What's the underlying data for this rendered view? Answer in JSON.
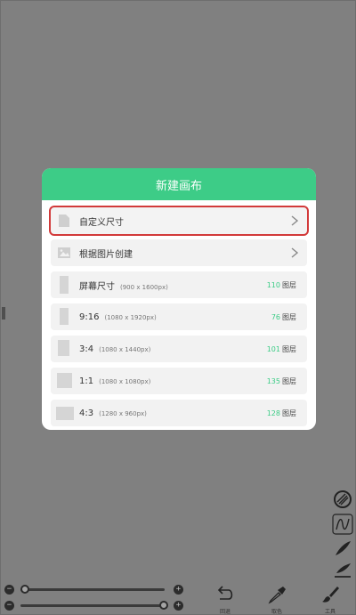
{
  "dialog": {
    "title": "新建画布",
    "options": [
      {
        "label": "自定义尺寸",
        "dims": "",
        "count": "",
        "layer": "",
        "icon": "document-icon",
        "chevron": true
      },
      {
        "label": "根据图片创建",
        "dims": "",
        "count": "",
        "layer": "",
        "icon": "image-icon",
        "chevron": true
      },
      {
        "label": "屏幕尺寸",
        "dims": "(900 x 1600px)",
        "count": "110",
        "layer": "图层",
        "icon": "portrait-thumb",
        "chevron": false
      },
      {
        "label": "9:16",
        "dims": "(1080 x 1920px)",
        "count": "76",
        "layer": "图层",
        "icon": "portrait-thumb",
        "chevron": false
      },
      {
        "label": "3:4",
        "dims": "(1080 x 1440px)",
        "count": "101",
        "layer": "图层",
        "icon": "portrait-thumb",
        "chevron": false
      },
      {
        "label": "1:1",
        "dims": "(1080 x 1080px)",
        "count": "135",
        "layer": "图层",
        "icon": "square-thumb",
        "chevron": false
      },
      {
        "label": "4:3",
        "dims": "(1280 x 960px)",
        "count": "128",
        "layer": "图层",
        "icon": "landscape-thumb",
        "chevron": false
      }
    ]
  },
  "toolbar": {
    "undo_label": "回退",
    "picker_label": "取色",
    "tools_label": "工具"
  },
  "sliders": {
    "minus": "−",
    "plus": "+"
  },
  "colors": {
    "accent": "#3dcc87",
    "overlay": "#808080",
    "highlight": "#d23a3a"
  }
}
